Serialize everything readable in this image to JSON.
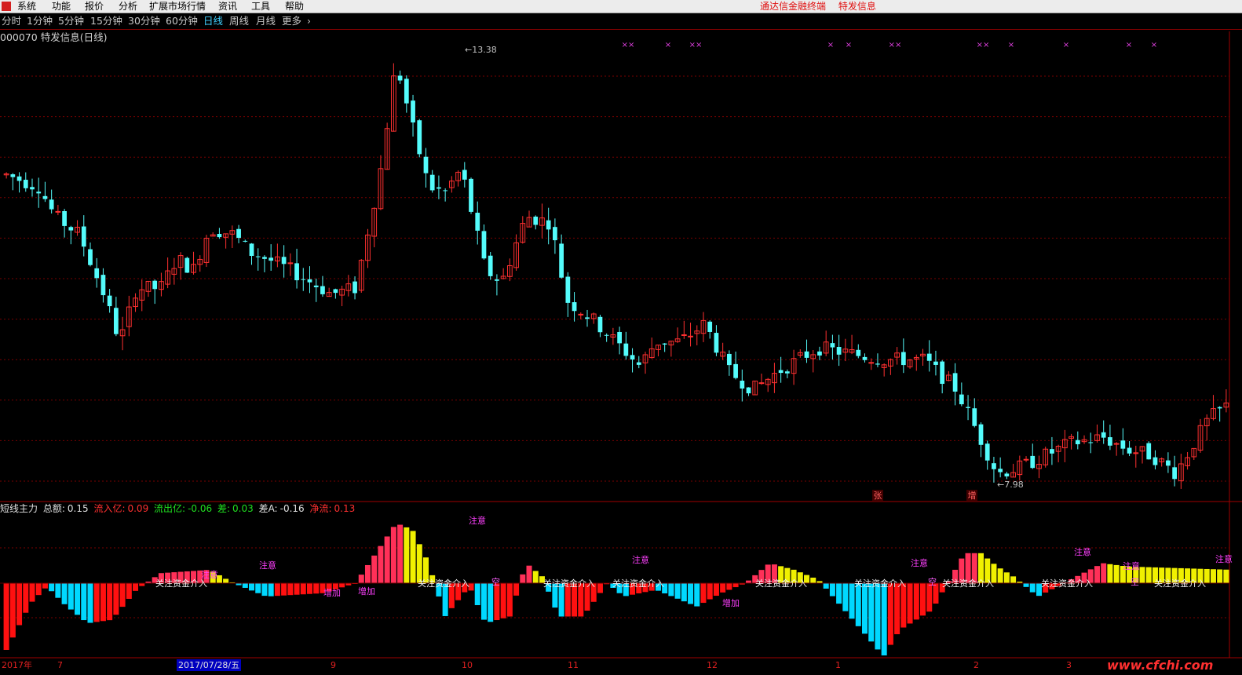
{
  "menu": {
    "items": [
      "系统",
      "功能",
      "报价",
      "分析",
      "扩展市场行情",
      "资讯",
      "工具",
      "帮助"
    ],
    "center_links": [
      "通达信金融终端",
      "特发信息"
    ]
  },
  "periods": {
    "items": [
      "分时",
      "1分钟",
      "5分钟",
      "15分钟",
      "30分钟",
      "60分钟",
      "日线",
      "周线",
      "月线",
      "更多"
    ],
    "active": "日线",
    "more_arrow": "›"
  },
  "stock": {
    "title": "000070 特发信息(日线)"
  },
  "chart_data": {
    "type": "candlestick",
    "price_max_label": "13.38",
    "price_min_label": "7.98",
    "markers_top": [
      "××",
      "×",
      "××",
      "×",
      "×",
      "××",
      "××",
      "×",
      "×",
      "×",
      "×"
    ],
    "markers_bottom": [
      "张",
      "增"
    ],
    "colors": {
      "up": "#ff3030",
      "down": "#54fcfc",
      "grid": "#7a0000",
      "hist_up_strong": "#ff3058",
      "hist_yellow": "#f0f000",
      "hist_down": "#00d8ff",
      "hist_red": "#ff1010"
    },
    "indicator": {
      "name": "短线主力",
      "annotations": [
        "关注资金介入",
        "注意",
        "空",
        "增加"
      ]
    }
  },
  "indicator_legend": {
    "name": "短线主力",
    "total_label": "总额:",
    "total_value": "0.15",
    "inflow_label": "流入亿:",
    "inflow_value": "0.09",
    "outflow_label": "流出亿:",
    "outflow_value": "-0.06",
    "diff_label": "差:",
    "diff_value": "0.03",
    "diffA_label": "差A:",
    "diffA_value": "-0.16",
    "net_label": "净流:",
    "net_value": "0.13"
  },
  "date_axis": {
    "labels": [
      "2017年",
      "7",
      "9",
      "10",
      "11",
      "12",
      "1",
      "2",
      "3"
    ],
    "highlight": "2017/07/28/五"
  },
  "watermark": "www.cfchi.com"
}
